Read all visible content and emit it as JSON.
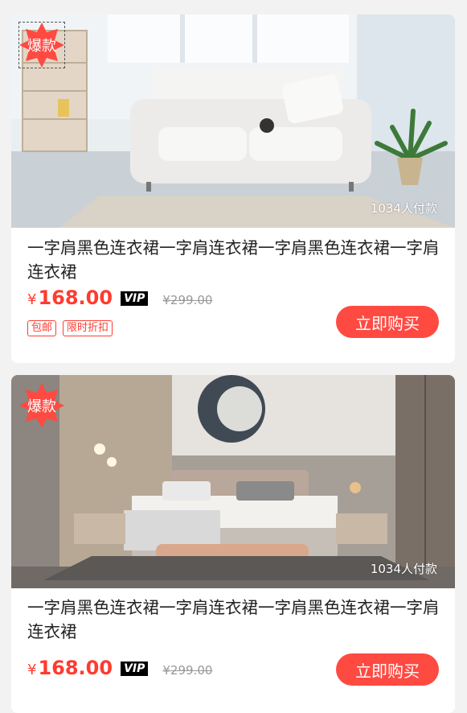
{
  "products": [
    {
      "badge": "爆款",
      "paid_count": "1034人付款",
      "title": "一字肩黑色连衣裙一字肩连衣裙一字肩黑色连衣裙一字肩连衣裙",
      "currency": "¥",
      "price": "168.00",
      "vip_label": "VIP",
      "original_price": "¥299.00",
      "tags": [
        "包邮",
        "限时折扣"
      ],
      "buy_label": "立即购买",
      "image": "living-room-sofa"
    },
    {
      "badge": "爆款",
      "paid_count": "1034人付款",
      "title": "一字肩黑色连衣裙一字肩连衣裙一字肩黑色连衣裙一字肩连衣裙",
      "currency": "¥",
      "price": "168.00",
      "vip_label": "VIP",
      "original_price": "¥299.00",
      "tags": [],
      "buy_label": "立即购买",
      "image": "bedroom-bed"
    }
  ],
  "colors": {
    "accent": "#ff3b30",
    "button": "#ff4a42",
    "background": "#f2f2f2"
  }
}
